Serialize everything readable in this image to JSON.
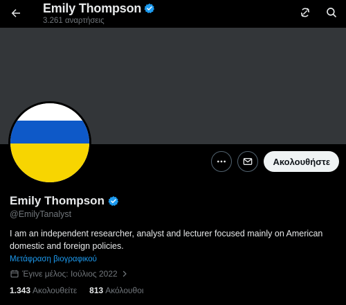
{
  "header": {
    "name": "Emily Thompson",
    "posts_count": "3.261 αναρτήσεις"
  },
  "actions": {
    "follow_label": "Ακολουθήστε"
  },
  "profile": {
    "display_name": "Emily Thompson",
    "handle": "@EmilyTanalyst",
    "bio": "I am an independent researcher, analyst and lecturer focused mainly on American domestic and foreign policies.",
    "translate_link": "Μετάφραση βιογραφικού",
    "joined": "Έγινε μέλος: Ιούλιος 2022",
    "following_count": "1.343",
    "following_label": "Ακολουθείτε",
    "followers_count": "813",
    "followers_label": "Ακόλουθοι"
  },
  "icons": {
    "back": "arrow-left-icon",
    "refresh": "refresh-icon",
    "search": "search-icon",
    "more": "more-icon",
    "message": "mail-icon",
    "verified": "verified-badge-icon",
    "calendar": "calendar-icon",
    "chevron": "chevron-right-icon"
  },
  "colors": {
    "background": "#000000",
    "banner": "#333639",
    "accent": "#1d9bf0",
    "muted_text": "#71767b",
    "primary_text": "#e7e9ea",
    "follow_button_bg": "#eff3f4",
    "flag_blue": "#0e59c8",
    "flag_yellow": "#f7d501"
  }
}
